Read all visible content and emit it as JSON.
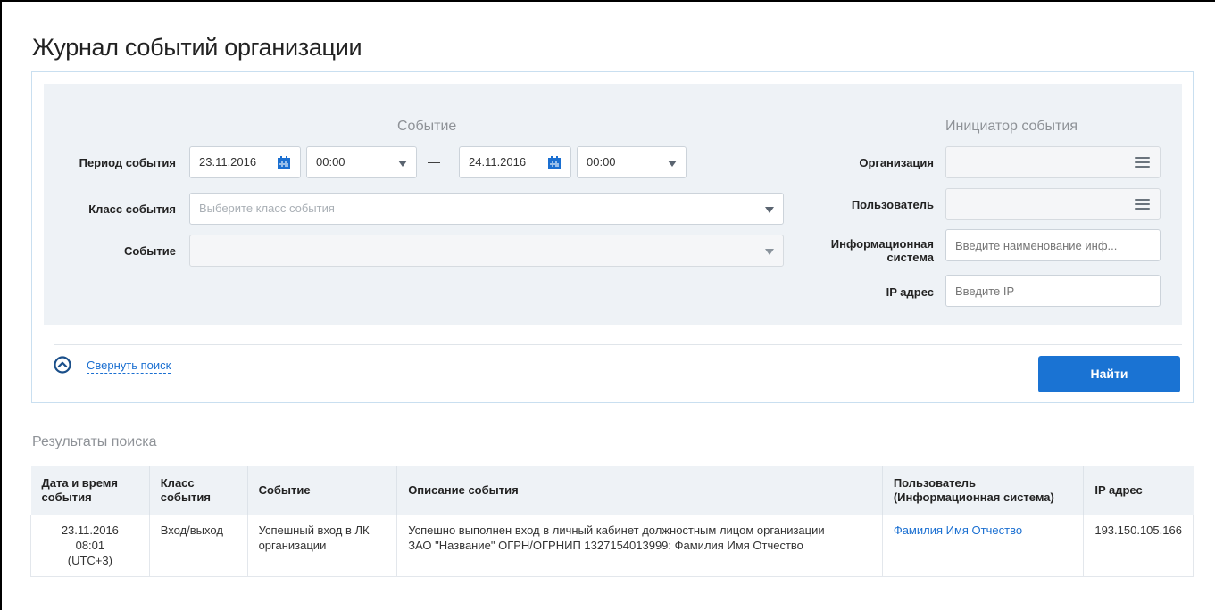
{
  "page": {
    "title": "Журнал событий организации"
  },
  "filters": {
    "event_section_title": "Событие",
    "initiator_section_title": "Инициатор события",
    "period": {
      "label": "Период события",
      "date_from": "23.11.2016",
      "time_from": "00:00",
      "separator": "—",
      "date_to": "24.11.2016",
      "time_to": "00:00"
    },
    "event_class": {
      "label": "Класс события",
      "placeholder": "Выберите класс события"
    },
    "event": {
      "label": "Событие",
      "value": ""
    },
    "organization": {
      "label": "Организация",
      "value": ""
    },
    "user": {
      "label": "Пользователь",
      "value": ""
    },
    "info_system": {
      "label_line1": "Информационная",
      "label_line2": "система",
      "placeholder": "Введите наименование инф..."
    },
    "ip": {
      "label": "IP адрес",
      "placeholder": "Введите IP"
    },
    "collapse_label": "Свернуть поиск",
    "find_label": "Найти"
  },
  "results": {
    "title": "Результаты поиска",
    "columns": [
      {
        "line1": "Дата и время",
        "line2": "события"
      },
      {
        "line1": "Класс",
        "line2": "события"
      },
      {
        "line1": "Событие",
        "line2": ""
      },
      {
        "line1": "Описание события",
        "line2": ""
      },
      {
        "line1": "Пользователь",
        "line2": "(Информационная система)"
      },
      {
        "line1": "IP адрес",
        "line2": ""
      }
    ],
    "rows": [
      {
        "date": "23.11.2016",
        "time": "08:01",
        "tz": "(UTC+3)",
        "class": "Вход/выход",
        "event_line1": "Успешный вход в ЛК",
        "event_line2": "организации",
        "description_line1": "Успешно выполнен вход в личный кабинет должностным лицом организации",
        "description_line2": "ЗАО \"Название\" ОГРН/ОГРНИП 1327154013999: Фамилия Имя Отчество",
        "user": "Фамилия Имя Отчество",
        "ip": "193.150.105.166"
      }
    ]
  },
  "colors": {
    "accent": "#1a73d3",
    "panel_bg": "#eef2f6",
    "panel_border": "#c9dff0"
  }
}
